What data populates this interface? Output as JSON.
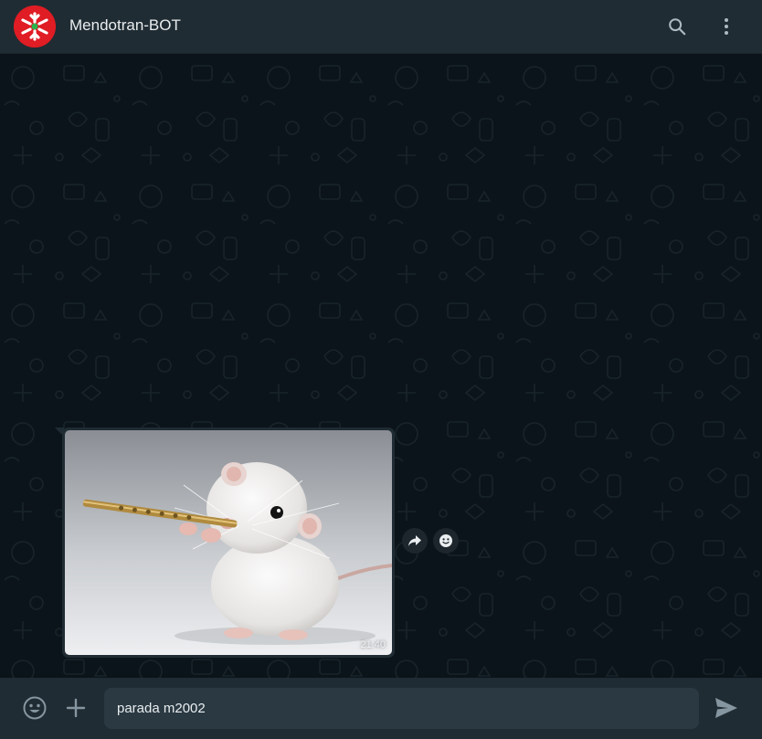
{
  "header": {
    "title": "Mendotran-BOT",
    "avatar_icon": "mendotran-logo-icon",
    "search_icon": "search-icon",
    "menu_icon": "kebab-menu-icon"
  },
  "message": {
    "image_description_icon": "rat-playing-flute-photo",
    "time": "21:40",
    "forward_icon": "forward-arrow-icon",
    "react_icon": "smiley-icon"
  },
  "composer": {
    "emoji_icon": "emoji-icon",
    "attach_icon": "plus-icon",
    "input_value": "parada m2002",
    "send_icon": "send-icon"
  },
  "colors": {
    "header_bg": "#202c33",
    "chat_bg": "#0b141a",
    "bubble_bg": "#202c33",
    "input_bg": "#2a3942",
    "avatar_red": "#e01c24"
  }
}
